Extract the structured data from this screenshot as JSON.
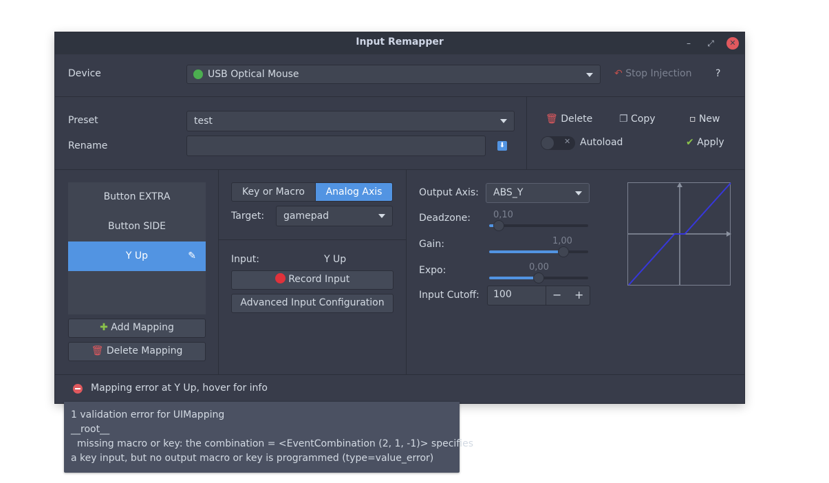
{
  "window": {
    "title": "Input Remapper",
    "controls": {
      "minimize": "–",
      "maximize": "⤢",
      "close": "✕"
    }
  },
  "device": {
    "label": "Device",
    "selected": "USB Optical Mouse",
    "stop_injection": "Stop Injection",
    "help": "?"
  },
  "preset": {
    "label": "Preset",
    "selected": "test",
    "rename_label": "Rename",
    "rename_value": "",
    "delete": "Delete",
    "copy": "Copy",
    "new": "New",
    "autoload": "Autoload",
    "autoload_on": false,
    "apply": "Apply"
  },
  "mappings": {
    "items": [
      {
        "label": "Button EXTRA"
      },
      {
        "label": "Button SIDE"
      },
      {
        "label": "Y Up"
      }
    ],
    "selected_index": 2,
    "add": "Add Mapping",
    "delete": "Delete Mapping"
  },
  "editor": {
    "tabs": [
      "Key or Macro",
      "Analog Axis"
    ],
    "active_tab": "Analog Axis",
    "target_label": "Target:",
    "target_value": "gamepad",
    "input_label": "Input:",
    "input_value": "Y Up",
    "record": "Record Input",
    "advanced": "Advanced Input Configuration"
  },
  "analog": {
    "output_axis_label": "Output Axis:",
    "output_axis_value": "ABS_Y",
    "deadzone_label": "Deadzone:",
    "deadzone_value": "0,10",
    "deadzone_fraction": 0.1,
    "gain_label": "Gain:",
    "gain_value": "1,00",
    "gain_fraction": 0.75,
    "expo_label": "Expo:",
    "expo_value": "0,00",
    "expo_fraction": 0.5,
    "cutoff_label": "Input Cutoff:",
    "cutoff_value": "100",
    "minus": "−",
    "plus": "+"
  },
  "status": {
    "message": "Mapping error at Y Up, hover for info"
  },
  "tooltip": {
    "lines": [
      "1 validation error for UIMapping",
      "__root__",
      "  missing macro or key: the combination = <EventCombination (2, 1, -1)> specifies",
      "a key input, but no output macro or key is programmed (type=value_error)"
    ]
  },
  "colors": {
    "accent": "#5294e2",
    "error": "#e0595e",
    "ok": "#8bc34a",
    "curve": "#3737dc"
  }
}
